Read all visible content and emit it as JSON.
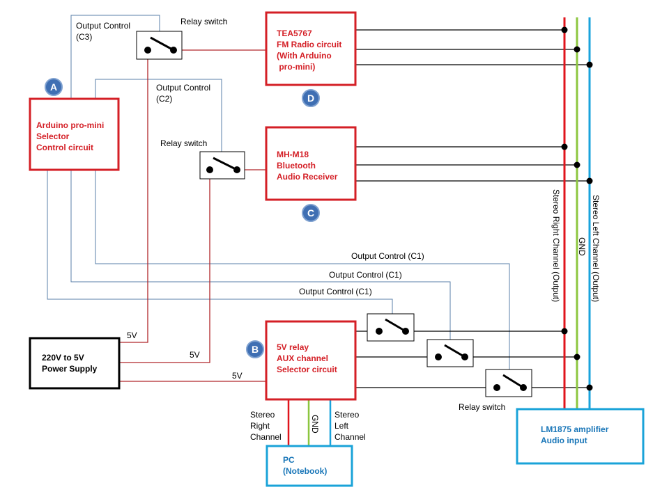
{
  "blocks": {
    "arduino": {
      "lines": [
        "Arduino pro-mini",
        "Selector",
        "Control circuit"
      ],
      "marker": "A"
    },
    "fm_radio": {
      "lines": [
        "TEA5767",
        "FM Radio  circuit",
        "(With Arduino",
        " pro-mini)"
      ],
      "marker": "D"
    },
    "bluetooth": {
      "lines": [
        "MH-M18",
        "Bluetooth",
        "Audio Receiver"
      ],
      "marker": "C"
    },
    "aux_selector": {
      "lines": [
        "5V relay",
        "AUX channel",
        "Selector circuit"
      ],
      "marker": "B"
    },
    "power_supply": {
      "lines": [
        "220V to 5V",
        "Power Supply"
      ]
    },
    "pc": {
      "lines": [
        "PC",
        "(Notebook)"
      ]
    },
    "amplifier": {
      "lines": [
        "LM1875 amplifier",
        "Audio input"
      ]
    }
  },
  "labels": {
    "relay_switch": "Relay switch",
    "output_c3": [
      "Output Control",
      "(C3)"
    ],
    "output_c2": [
      "Output Control",
      "(C2)"
    ],
    "output_c1": "Output Control (C1)",
    "five_v": "5V",
    "stereo_right": [
      "Stereo",
      "Right",
      "Channel"
    ],
    "stereo_left": [
      "Stereo",
      "Left",
      "Channel"
    ],
    "gnd": "GND",
    "bus_right": "Stereo Right Channel (Output)",
    "bus_gnd": "GND",
    "bus_left": "Stereo Left Channel (Output)"
  },
  "colors": {
    "block_red": "#d41f26",
    "control_blue": "#5a7fa8",
    "bus_red": "#e0141c",
    "bus_green": "#8cc63f",
    "bus_blue": "#1aa3dc",
    "io_cyan": "#1aa3d8"
  }
}
